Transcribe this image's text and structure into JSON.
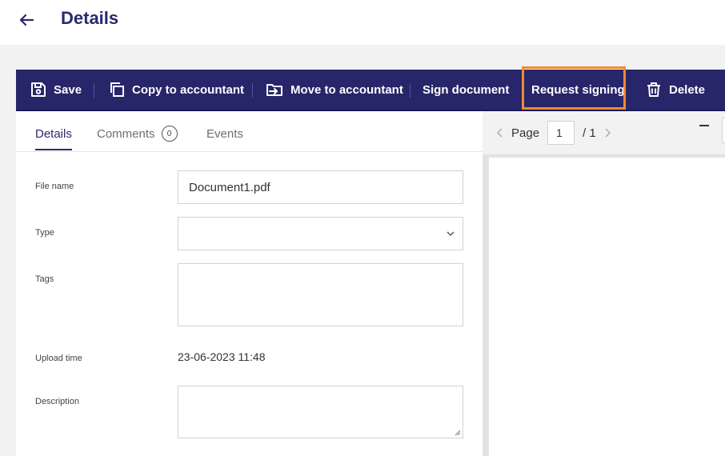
{
  "header": {
    "title": "Details"
  },
  "toolbar": {
    "save": "Save",
    "copy": "Copy to accountant",
    "move": "Move to accountant",
    "sign": "Sign document",
    "request": "Request signing",
    "delete": "Delete"
  },
  "tabs": {
    "details": "Details",
    "comments": "Comments",
    "comments_count": "0",
    "events": "Events"
  },
  "form": {
    "file_name_label": "File name",
    "file_name_value": "Document1.pdf",
    "type_label": "Type",
    "type_value": "",
    "tags_label": "Tags",
    "upload_time_label": "Upload time",
    "upload_time_value": "23-06-2023 11:48",
    "description_label": "Description"
  },
  "viewer": {
    "page_label": "Page",
    "page_current": "1",
    "page_total": "/ 1"
  },
  "colors": {
    "brand": "#27266a",
    "highlight": "#f28a30"
  }
}
